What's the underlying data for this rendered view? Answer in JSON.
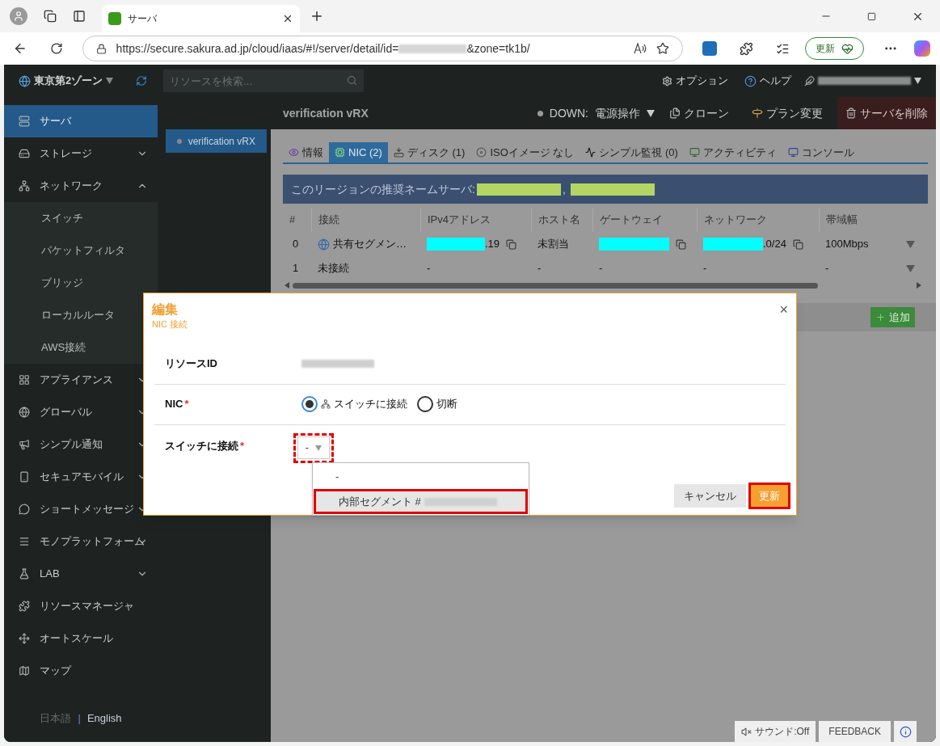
{
  "browser": {
    "tab_title": "サーバ",
    "url_prefix": "https://secure.sakura.ad.jp/cloud/iaas/#!/server/detail/id=",
    "url_suffix": "&zone=tk1b/",
    "update_button": "更新"
  },
  "header": {
    "zone": "東京第2ゾーン",
    "search_placeholder": "リソースを検索...",
    "options": "オプション",
    "help": "ヘルプ"
  },
  "sidebar": {
    "items": [
      {
        "label": "サーバ",
        "selected": true
      },
      {
        "label": "ストレージ",
        "selected": false,
        "expanded": false
      },
      {
        "label": "ネットワーク",
        "selected": false,
        "expanded": true,
        "children": [
          {
            "label": "スイッチ",
            "selected": false
          },
          {
            "label": "パケットフィルタ",
            "selected": false
          },
          {
            "label": "ブリッジ",
            "selected": false
          },
          {
            "label": "ローカルルータ",
            "selected": false
          },
          {
            "label": "AWS接続",
            "selected": false
          }
        ]
      },
      {
        "label": "アプライアンス",
        "selected": false,
        "expanded": false
      },
      {
        "label": "グローバル",
        "selected": false,
        "expanded": false
      },
      {
        "label": "シンプル通知",
        "selected": false,
        "expanded": false
      },
      {
        "label": "セキュアモバイル",
        "selected": false,
        "expanded": false
      },
      {
        "label": "ショートメッセージ",
        "selected": false,
        "expanded": false
      },
      {
        "label": "モノプラットフォーム",
        "selected": false,
        "expanded": false
      },
      {
        "label": "LAB",
        "selected": false,
        "expanded": false
      },
      {
        "label": "リソースマネージャ",
        "selected": false
      },
      {
        "label": "オートスケール",
        "selected": false
      },
      {
        "label": "マップ",
        "selected": false
      }
    ],
    "languages": [
      {
        "label": "日本語",
        "selected": true
      },
      {
        "label": "English",
        "selected": false
      }
    ],
    "language_separator": "|"
  },
  "server_list": [
    {
      "name": "verification vRX",
      "selected": true
    }
  ],
  "server": {
    "title": "verification vRX",
    "status": "DOWN:",
    "power_menu": "電源操作",
    "actions": [
      "クローン",
      "プラン変更",
      "サーバを削除"
    ]
  },
  "tabs": [
    {
      "label": "情報",
      "selected": false
    },
    {
      "label": "NIC (2)",
      "selected": true
    },
    {
      "label": "ディスク (1)",
      "selected": false
    },
    {
      "label": "ISOイメージ なし",
      "selected": false
    },
    {
      "label": "シンプル監視 (0)",
      "selected": false
    },
    {
      "label": "アクティビティ",
      "selected": false
    },
    {
      "label": "コンソール",
      "selected": false
    }
  ],
  "banner": {
    "text": "このリージョンの推奨ネームサーバ:",
    "separator": ","
  },
  "table": {
    "columns": [
      "#",
      "接続",
      "IPv4アドレス",
      "ホスト名",
      "ゲートウェイ",
      "ネットワーク",
      "帯域幅"
    ],
    "rows": [
      {
        "index": "0",
        "connection": "共有セグメン…",
        "shared": true,
        "ipv4": ".19",
        "hostname": "未割当",
        "network": ".0/24",
        "bandwidth": "100Mbps",
        "masked": true
      },
      {
        "index": "1",
        "connection": "未接続",
        "ipv4": "-",
        "hostname": "-",
        "gateway": "-",
        "network": "-",
        "bandwidth": "-"
      }
    ]
  },
  "add_button": "追加",
  "modal": {
    "title": "編集",
    "subtitle": "NIC 接続",
    "close": "×",
    "resource_label": "リソースID",
    "nic_label": "NIC",
    "nic_required_mark": "*",
    "nic_options": [
      {
        "label": "スイッチに接続",
        "selected": true
      },
      {
        "label": "切断",
        "selected": false
      }
    ],
    "switch_label": "スイッチに接続",
    "switch_required_mark": "*",
    "switch_value": "-",
    "dropdown": [
      {
        "label": "-",
        "selected": false
      },
      {
        "label": "内部セグメント #",
        "selected": true
      }
    ],
    "cancel": "キャンセル",
    "submit": "更新"
  },
  "footer": {
    "sound": "サウンド:Off",
    "feedback": "FEEDBACK"
  }
}
